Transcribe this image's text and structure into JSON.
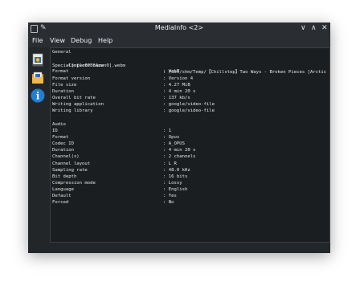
{
  "window": {
    "title": "MediaInfo <2>",
    "controls": {
      "minimize": "∨",
      "maximize": "∧",
      "close": "✕"
    }
  },
  "menu": {
    "items": [
      "File",
      "View",
      "Debug",
      "Help"
    ]
  },
  "sidebar": {
    "buttons": [
      {
        "icon": "open-file-icon"
      },
      {
        "icon": "open-folder-icon"
      },
      {
        "icon": "about-icon",
        "glyph": "i"
      }
    ]
  },
  "report": {
    "general_header": "General",
    "complete_name_label": "Complete name",
    "complete_name_value": "/dev/shm/Temp/【Chillstep】Two Ways - Broken Pieces [Arctic",
    "complete_name_cont": "Special] [wc0PB6Azwn0].webm",
    "general": [
      {
        "label": "Format",
        "value": "WebM"
      },
      {
        "label": "Format version",
        "value": "Version 4"
      },
      {
        "label": "File size",
        "value": "4.27 MiB"
      },
      {
        "label": "Duration",
        "value": "4 min 20 s"
      },
      {
        "label": "Overall bit rate",
        "value": "137 kb/s"
      },
      {
        "label": "Writing application",
        "value": "google/video-file"
      },
      {
        "label": "Writing library",
        "value": "google/video-file"
      }
    ],
    "audio_header": "Audio",
    "audio": [
      {
        "label": "ID",
        "value": "1"
      },
      {
        "label": "Format",
        "value": "Opus"
      },
      {
        "label": "Codec ID",
        "value": "A_OPUS"
      },
      {
        "label": "Duration",
        "value": "4 min 20 s"
      },
      {
        "label": "Channel(s)",
        "value": "2 channels"
      },
      {
        "label": "Channel layout",
        "value": "L R"
      },
      {
        "label": "Sampling rate",
        "value": "48.0 kHz"
      },
      {
        "label": "Bit depth",
        "value": "16 bits"
      },
      {
        "label": "Compression mode",
        "value": "Lossy"
      },
      {
        "label": "Language",
        "value": "English"
      },
      {
        "label": "Default",
        "value": "Yes"
      },
      {
        "label": "Forced",
        "value": "No"
      }
    ],
    "separator": ": "
  },
  "colors": {
    "window_bg": "#232629",
    "content_bg": "#1b1e20",
    "text": "#e6e6e6",
    "about_icon_blue": "#1f7fd6"
  }
}
